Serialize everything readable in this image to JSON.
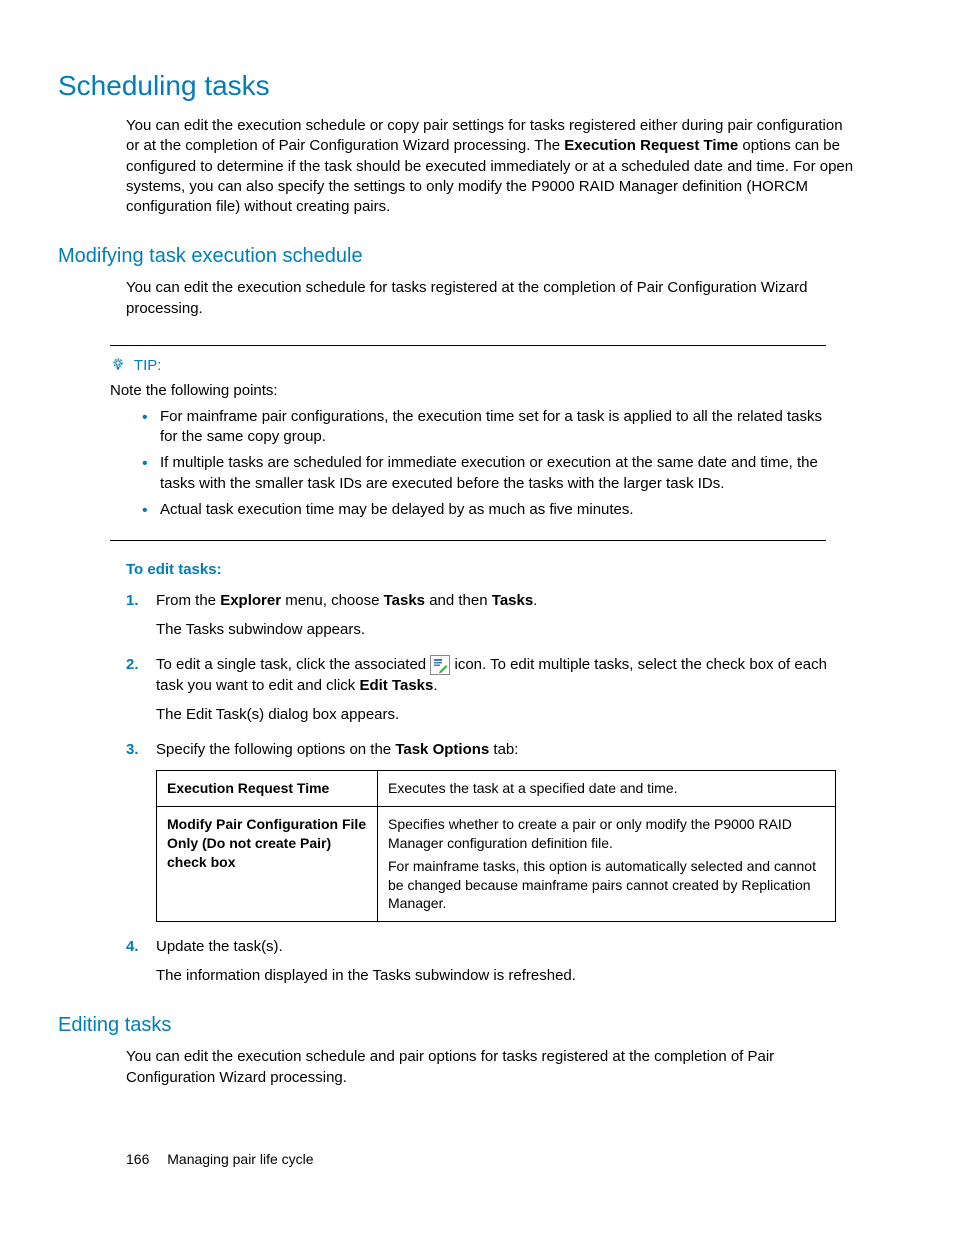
{
  "headings": {
    "h1": "Scheduling tasks",
    "h2a": "Modifying task execution schedule",
    "h2b": "Editing tasks"
  },
  "intro": {
    "p1_a": "You can edit the execution schedule or copy pair settings for tasks registered either during pair configuration or at the completion of Pair Configuration Wizard processing. The ",
    "p1_b": "Execution Request Time",
    "p1_c": " options can be configured to determine if the task should be executed immediately or at a scheduled date and time. For open systems, you can also specify the settings to only modify the P9000 RAID Manager definition (HORCM configuration file) without creating pairs."
  },
  "mod": {
    "p1": "You can edit the execution schedule for tasks registered at the completion of Pair Configuration Wizard processing."
  },
  "tip": {
    "label": "TIP:",
    "intro": "Note the following points:",
    "bullets": [
      "For mainframe pair configurations, the execution time set for a task is applied to all the related tasks for the same copy group.",
      "If multiple tasks are scheduled for immediate execution or execution at the same date and time, the tasks with the smaller task IDs are executed before the tasks with the larger task IDs.",
      "Actual task execution time may be delayed by as much as five minutes."
    ]
  },
  "toedit": {
    "title": "To edit tasks:",
    "s1_a": "From the ",
    "s1_b": "Explorer",
    "s1_c": " menu, choose ",
    "s1_d": "Tasks",
    "s1_e": " and then ",
    "s1_f": "Tasks",
    "s1_g": ".",
    "s1_sub": "The Tasks subwindow appears.",
    "s2_a": "To edit a single task, click the associated ",
    "s2_b": " icon. To edit multiple tasks, select the check box of each task you want to edit and click ",
    "s2_c": "Edit Tasks",
    "s2_d": ".",
    "s2_sub": "The Edit Task(s) dialog box appears.",
    "s3_a": "Specify the following options on the ",
    "s3_b": "Task Options",
    "s3_c": " tab:",
    "s4": "Update the task(s).",
    "s4_sub": "The information displayed in the Tasks subwindow is refreshed."
  },
  "table": {
    "r1_l": "Execution Request Time",
    "r1_r": "Executes the task at a specified date and time.",
    "r2_l": "Modify Pair Configuration File Only (Do not create Pair) check box",
    "r2_r1": "Specifies whether to create a pair or only modify the P9000 RAID Manager configuration definition file.",
    "r2_r2": "For mainframe tasks, this option is automatically selected and cannot be changed because mainframe pairs cannot created by Replication Manager."
  },
  "editing": {
    "p1": "You can edit the execution schedule and pair options for tasks registered at the completion of Pair Configuration Wizard processing."
  },
  "footer": {
    "page": "166",
    "title": "Managing pair life cycle"
  }
}
